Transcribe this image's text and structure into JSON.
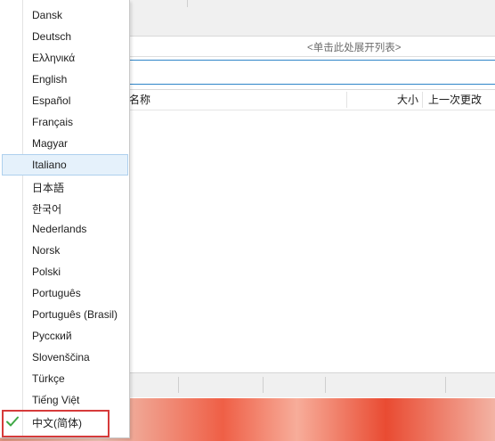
{
  "app": {
    "expand_list_text": "<单击此处展开列表>",
    "columns": {
      "name": "名称",
      "size": "大小",
      "modified": "上一次更改"
    }
  },
  "language_menu": {
    "items": [
      {
        "label": "Dansk"
      },
      {
        "label": "Deutsch"
      },
      {
        "label": "Ελληνικά"
      },
      {
        "label": "English"
      },
      {
        "label": "Español"
      },
      {
        "label": "Français"
      },
      {
        "label": "Magyar"
      },
      {
        "label": "Italiano",
        "state": "hovered"
      },
      {
        "label": "日本語"
      },
      {
        "label": "한국어"
      },
      {
        "label": "Nederlands"
      },
      {
        "label": "Norsk"
      },
      {
        "label": "Polski"
      },
      {
        "label": "Português"
      },
      {
        "label": "Português (Brasil)"
      },
      {
        "label": "Русский"
      },
      {
        "label": "Slovenščina"
      },
      {
        "label": "Türkçe"
      },
      {
        "label": "Tiếng Việt"
      },
      {
        "label": "中文(简体)",
        "state": "checked"
      }
    ],
    "check_icon": "check-icon",
    "colors": {
      "check": "#3ea845",
      "hover_bg": "#e5f1fb",
      "annotation_border": "#d63a3a"
    }
  }
}
